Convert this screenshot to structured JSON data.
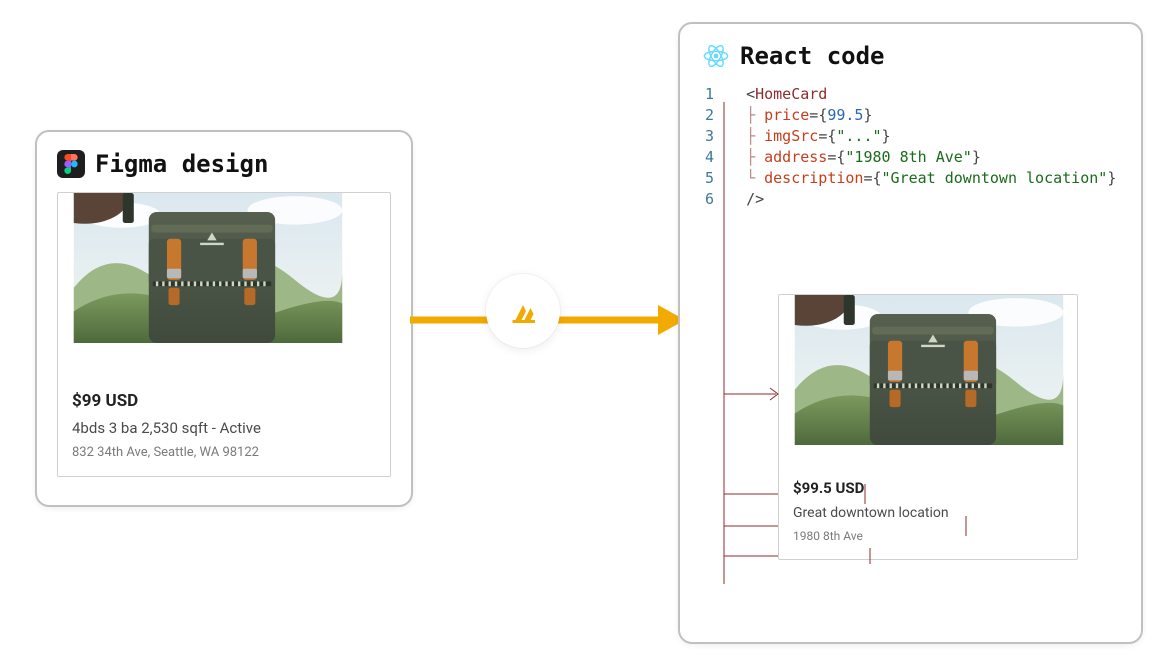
{
  "left_panel": {
    "title": "Figma design",
    "card": {
      "price": "$99 USD",
      "description": "4bds 3 ba 2,530 sqft - Active",
      "address": "832 34th Ave, Seattle, WA 98122"
    }
  },
  "right_panel": {
    "title": "React code",
    "code": {
      "line_numbers": [
        "1",
        "2",
        "3",
        "4",
        "5",
        "6"
      ],
      "line1": {
        "open": "<",
        "component": "HomeCard"
      },
      "line2": {
        "guide": "├ ",
        "attr": "price",
        "eq": "=",
        "br_open": "{",
        "value": "99.5",
        "br_close": "}"
      },
      "line3": {
        "guide": "├ ",
        "attr": "imgSrc",
        "eq": "=",
        "br_open": "{",
        "value": "\"...\"",
        "br_close": "}"
      },
      "line4": {
        "guide": "├ ",
        "attr": "address",
        "eq": "=",
        "br_open": "{",
        "value": "\"1980 8th Ave\"",
        "br_close": "}"
      },
      "line5": {
        "guide": "└ ",
        "attr": "description",
        "eq": "=",
        "br_open": "{",
        "value": "\"Great downtown location\"",
        "br_close": "}"
      },
      "line6": {
        "close": "/>"
      }
    },
    "card": {
      "price": "$99.5 USD",
      "description": "Great downtown location",
      "address": "1980 8th Ave"
    }
  },
  "icons": {
    "figma": "figma-icon",
    "react": "react-icon",
    "amplify": "amplify-icon"
  },
  "colors": {
    "arrow": "#f2a900",
    "annotation": "#8e2b2b",
    "panel_border": "#c0c0c0"
  }
}
